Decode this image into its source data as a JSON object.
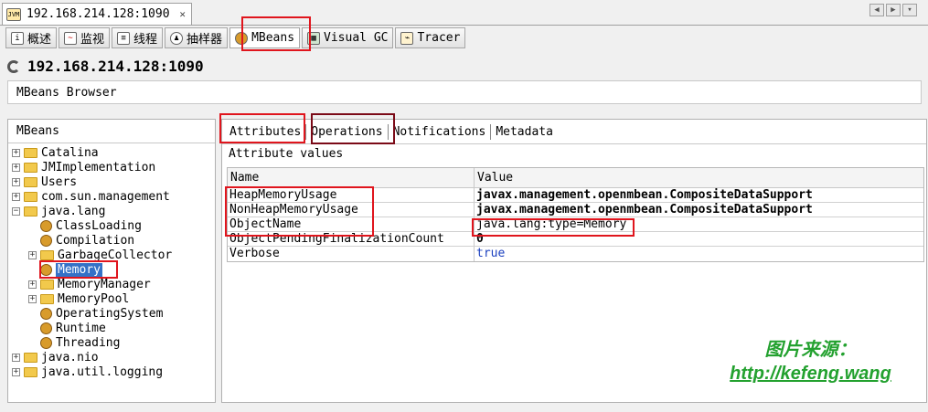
{
  "window": {
    "tab_title": "192.168.214.128:1090",
    "close_glyph": "✕",
    "nav_prev": "◀",
    "nav_next": "▶",
    "nav_menu": "▾"
  },
  "toolbar": {
    "tabs": [
      {
        "label": "概述",
        "icon": "overview-icon"
      },
      {
        "label": "监视",
        "icon": "monitor-icon"
      },
      {
        "label": "线程",
        "icon": "threads-icon"
      },
      {
        "label": "抽样器",
        "icon": "sampler-icon"
      },
      {
        "label": "MBeans",
        "icon": "mbeans-icon",
        "active": true
      },
      {
        "label": "Visual GC",
        "icon": "visualgc-icon"
      },
      {
        "label": "Tracer",
        "icon": "tracer-icon"
      }
    ]
  },
  "host": {
    "title": "192.168.214.128:1090"
  },
  "browser": {
    "header": "MBeans Browser"
  },
  "tree": {
    "header": "MBeans",
    "nodes": [
      {
        "label": "Catalina",
        "level": 0,
        "type": "folder",
        "expand": "+"
      },
      {
        "label": "JMImplementation",
        "level": 0,
        "type": "folder",
        "expand": "+"
      },
      {
        "label": "Users",
        "level": 0,
        "type": "folder",
        "expand": "+"
      },
      {
        "label": "com.sun.management",
        "level": 0,
        "type": "folder",
        "expand": "+"
      },
      {
        "label": "java.lang",
        "level": 0,
        "type": "folder",
        "expand": "−"
      },
      {
        "label": "ClassLoading",
        "level": 1,
        "type": "bean"
      },
      {
        "label": "Compilation",
        "level": 1,
        "type": "bean"
      },
      {
        "label": "GarbageCollector",
        "level": 1,
        "type": "folder",
        "expand": "+"
      },
      {
        "label": "Memory",
        "level": 1,
        "type": "bean",
        "selected": true
      },
      {
        "label": "MemoryManager",
        "level": 1,
        "type": "folder",
        "expand": "+"
      },
      {
        "label": "MemoryPool",
        "level": 1,
        "type": "folder",
        "expand": "+"
      },
      {
        "label": "OperatingSystem",
        "level": 1,
        "type": "bean"
      },
      {
        "label": "Runtime",
        "level": 1,
        "type": "bean"
      },
      {
        "label": "Threading",
        "level": 1,
        "type": "bean"
      },
      {
        "label": "java.nio",
        "level": 0,
        "type": "folder",
        "expand": "+"
      },
      {
        "label": "java.util.logging",
        "level": 0,
        "type": "folder",
        "expand": "+"
      }
    ]
  },
  "subtabs": [
    "Attributes",
    "Operations",
    "Notifications",
    "Metadata"
  ],
  "attributes": {
    "label": "Attribute values",
    "columns": [
      "Name",
      "Value"
    ],
    "rows": [
      {
        "name": "HeapMemoryUsage",
        "value": "javax.management.openmbean.CompositeDataSupport",
        "style": "bold"
      },
      {
        "name": "NonHeapMemoryUsage",
        "value": "javax.management.openmbean.CompositeDataSupport",
        "style": "bold"
      },
      {
        "name": "ObjectName",
        "value": "java.lang:type=Memory",
        "style": "plain"
      },
      {
        "name": "ObjectPendingFinalizationCount",
        "value": "0",
        "style": "bold"
      },
      {
        "name": "Verbose",
        "value": "true",
        "style": "blue"
      }
    ]
  },
  "watermark": {
    "line1": "图片来源：",
    "line2": "http://kefeng.wang"
  },
  "colors": {
    "highlight_red": "#e0151d",
    "highlight_darkred": "#7b0a17",
    "selection": "#3471c7",
    "watermark_green": "#23a12f"
  }
}
